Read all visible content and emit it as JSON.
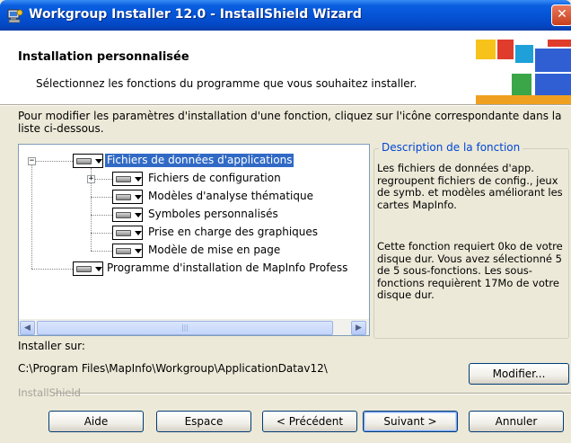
{
  "window": {
    "title": "Workgroup Installer 12.0 - InstallShield Wizard",
    "close_glyph": "✕",
    "app_icon": "installer-computer-icon"
  },
  "header": {
    "title": "Installation personnalisée",
    "subtitle": "Sélectionnez les fonctions du programme que vous souhaitez installer."
  },
  "intro": "Pour modifier les paramètres d'installation d'une fonction, cliquez sur l'icône correspondante dans la liste ci-dessous.",
  "tree": {
    "root": {
      "label": "Fichiers de données d'applications",
      "expanded": true,
      "selected": true
    },
    "children": [
      {
        "label": "Fichiers de configuration",
        "has_expander": true
      },
      {
        "label": "Modèles d'analyse thématique"
      },
      {
        "label": "Symboles personnalisés"
      },
      {
        "label": "Prise en charge des graphiques"
      },
      {
        "label": "Modèle de mise en page"
      }
    ],
    "second_root": {
      "label": "Programme d'installation de MapInfo Profess"
    }
  },
  "description": {
    "legend": "Description de la fonction",
    "text": "Les fichiers de données d'app. regroupent fichiers de config., jeux de symb. et modèles améliorant les cartes MapInfo.",
    "requirements": "Cette fonction requiert 0ko de votre disque dur. Vous avez sélectionné 5 de 5 sous-fonctions. Les sous-fonctions requièrent 17Mo de votre disque dur."
  },
  "install": {
    "label": "Installer sur:",
    "path": "C:\\Program Files\\MapInfo\\Workgroup\\ApplicationDatav12\\",
    "modify_button": "Modifier..."
  },
  "footer": {
    "brand": "InstallShield",
    "buttons": {
      "help": "Aide",
      "space": "Espace",
      "back": "< Précédent",
      "next": "Suivant >",
      "cancel": "Annuler"
    }
  },
  "colors": {
    "title_bar": "#0554d6",
    "selection": "#316ac5",
    "legend_text": "#0046d5",
    "dialog_bg": "#ece9d8",
    "logo": [
      "#2f5fd3",
      "#1fa0d8",
      "#3aa648",
      "#f0a020",
      "#e03c2c",
      "#f7c31a"
    ]
  }
}
